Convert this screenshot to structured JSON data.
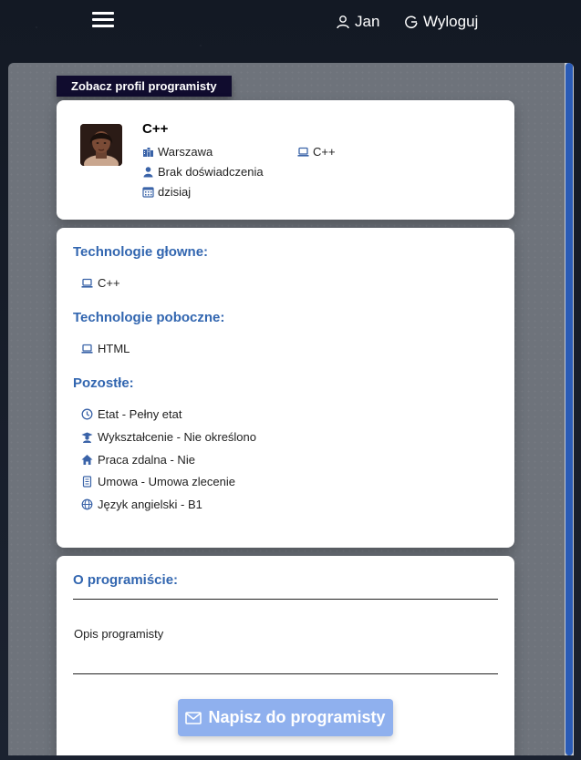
{
  "nav": {
    "user_name": "Jan",
    "logout_label": "Wyloguj"
  },
  "view_tag": "Zobacz profil programisty",
  "profile": {
    "title": "C++",
    "city": "Warszawa",
    "main_tech": "C++",
    "experience": "Brak doświadczenia",
    "date": "dzisiaj"
  },
  "technologies": {
    "main_title": "Technologie głowne:",
    "main_items": [
      "C++"
    ],
    "secondary_title": "Technologie poboczne:",
    "secondary_items": [
      "HTML"
    ],
    "other_title": "Pozostłe:",
    "other_items": [
      {
        "icon": "clock-icon",
        "label": "Etat - Pełny etat"
      },
      {
        "icon": "graduation-icon",
        "label": "Wykształcenie - Nie określono"
      },
      {
        "icon": "home-icon",
        "label": "Praca zdalna - Nie"
      },
      {
        "icon": "document-icon",
        "label": "Umowa - Umowa zlecenie"
      },
      {
        "icon": "globe-icon",
        "label": "Język angielski - B1"
      }
    ]
  },
  "about": {
    "title": "O programiście:",
    "description": "Opis programisty",
    "button_label": "Napisz do programisty"
  },
  "colors": {
    "accent_blue": "#3266b0",
    "button_blue": "#8fb0ee",
    "tag_dark": "#100c2e",
    "panel_gray": "#6e737b"
  }
}
